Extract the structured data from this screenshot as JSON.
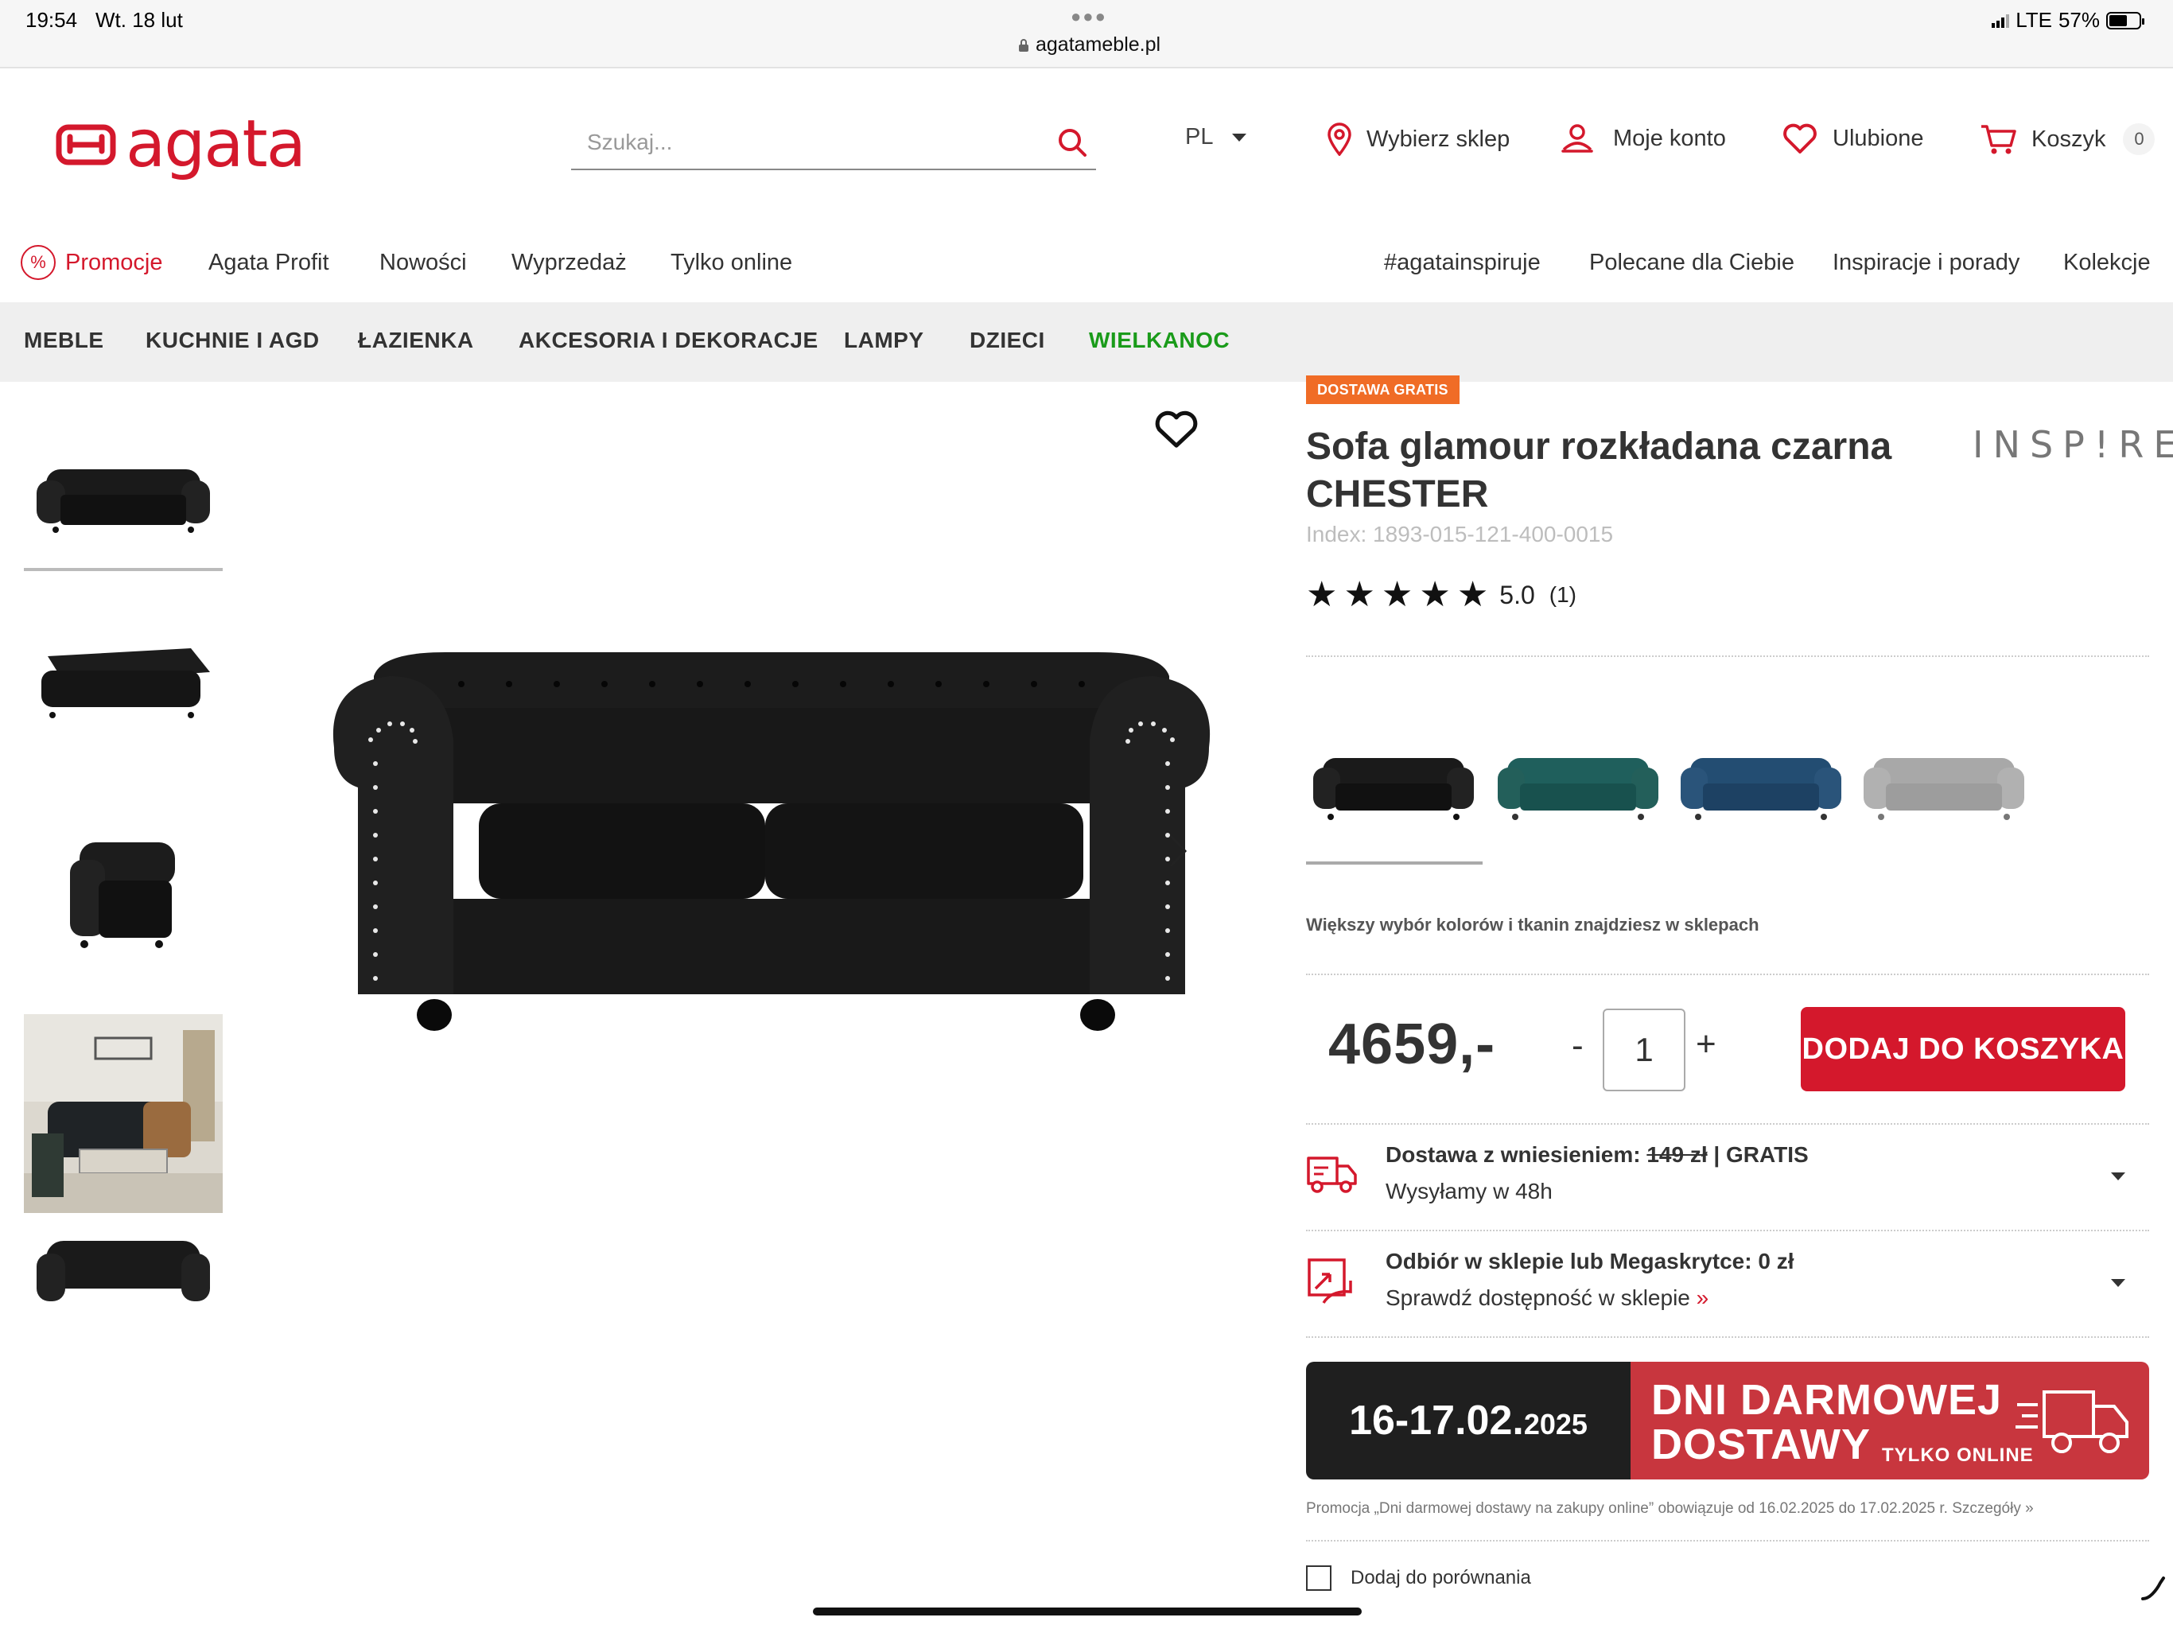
{
  "status_bar": {
    "time": "19:54",
    "date": "Wt. 18 lut",
    "url": "agatameble.pl",
    "network": "LTE",
    "battery": "57%"
  },
  "header": {
    "logo_text": "agata",
    "search_placeholder": "Szukaj...",
    "language": "PL",
    "links": {
      "store": "Wybierz sklep",
      "account": "Moje konto",
      "favorites": "Ulubione",
      "cart": "Koszyk",
      "cart_count": "0"
    }
  },
  "nav_primary": {
    "left": [
      "Promocje",
      "Agata Profit",
      "Nowości",
      "Wyprzedaż",
      "Tylko online"
    ],
    "right": [
      "#agatainspiruje",
      "Polecane dla Ciebie",
      "Inspiracje i porady",
      "Kolekcje"
    ]
  },
  "nav_categories": [
    "MEBLE",
    "KUCHNIE I AGD",
    "ŁAZIENKA",
    "AKCESORIA I DEKORACJE",
    "LAMPY",
    "DZIECI",
    "WIELKANOC"
  ],
  "product": {
    "badge": "DOSTAWA GRATIS",
    "brand": "INSP!RE",
    "title": "Sofa glamour rozkładana czarna CHESTER",
    "index": "Index: 1893-015-121-400-0015",
    "rating": 5,
    "rating_label": "5.0",
    "rating_count": "(1)",
    "variants": [
      {
        "name": "black",
        "color": "#1a1a1a"
      },
      {
        "name": "teal",
        "color": "#1f5f5c"
      },
      {
        "name": "blue",
        "color": "#234d72"
      },
      {
        "name": "grey",
        "color": "#a8a8a8"
      }
    ],
    "more_colors_note": "Większy wybór kolorów i tkanin znajdziesz w sklepach",
    "price": "4659,-",
    "quantity": "1",
    "qty_minus": "-",
    "qty_plus": "+",
    "add_to_cart": "DODAJ DO KOSZYKA"
  },
  "shipping": {
    "delivery_title_prefix": "Dostawa z wniesieniem:",
    "delivery_old_price": "149 zł",
    "delivery_free": "| GRATIS",
    "delivery_sub": "Wysyłamy w 48h",
    "pickup_title": "Odbiór w sklepie lub Megaskrytce: 0 zł",
    "pickup_sub": "Sprawdź dostępność w sklepie",
    "pickup_sub_arrow": "»"
  },
  "banner": {
    "dates": "16-17.02.",
    "year": "2025",
    "line1": "DNI DARMOWEJ",
    "line2": "DOSTAWY",
    "line3": "TYLKO ONLINE"
  },
  "promo_note": "Promocja „Dni darmowej dostawy na zakupy online” obowiązuje od 16.02.2025 do 17.02.2025 r. Szczegóły »",
  "compare_label": "Dodaj do porównania",
  "colors": {
    "brand_red": "#d4182c",
    "badge_orange": "#f06c26",
    "easter_green": "#1a9b1a"
  }
}
